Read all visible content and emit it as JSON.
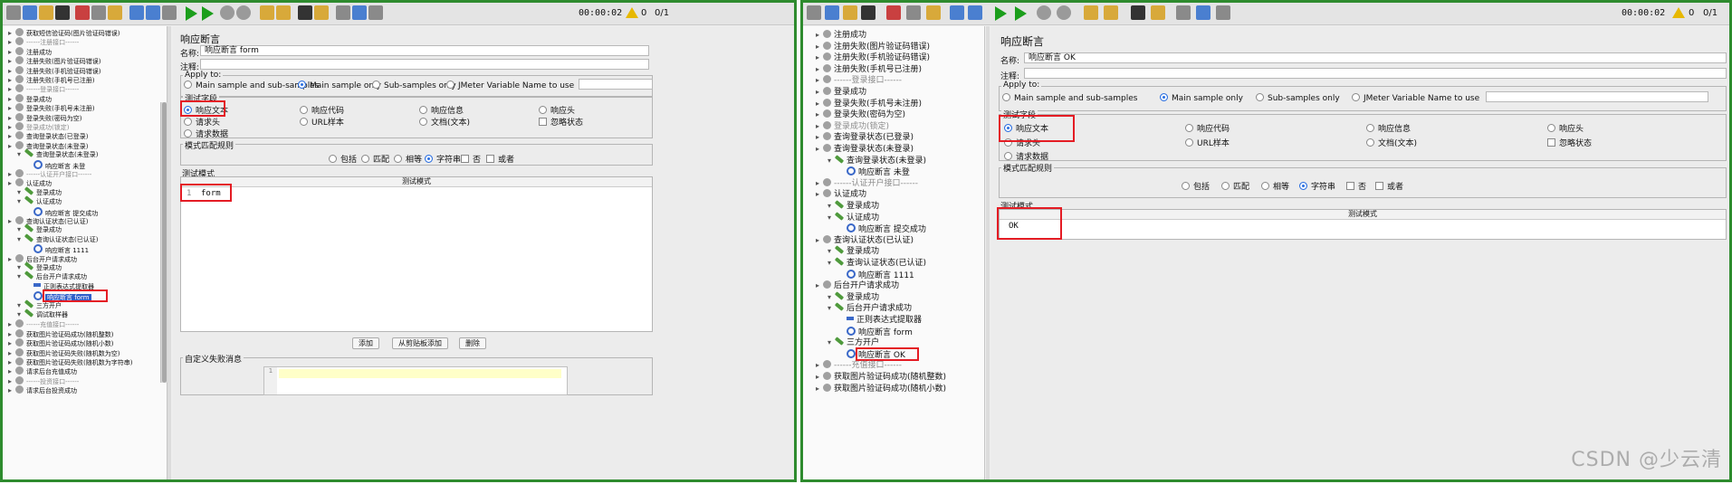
{
  "toolbar": {
    "timer": "00:00:02",
    "warnings": "0",
    "threads": "0/1"
  },
  "left_tree": [
    {
      "text": "获取短信验证码(图片验证码错误)",
      "icon": "g",
      "lvl": 1
    },
    {
      "text": "------注册接口------",
      "icon": "g",
      "lvl": 1,
      "dim": true
    },
    {
      "text": "注册成功",
      "icon": "g",
      "lvl": 1
    },
    {
      "text": "注册失败(图片验证码错误)",
      "icon": "g",
      "lvl": 1
    },
    {
      "text": "注册失败(手机验证码错误)",
      "icon": "g",
      "lvl": 1
    },
    {
      "text": "注册失败(手机号已注册)",
      "icon": "g",
      "lvl": 1
    },
    {
      "text": "------登录接口------",
      "icon": "g",
      "lvl": 1,
      "dim": true
    },
    {
      "text": "登录成功",
      "icon": "g",
      "lvl": 1
    },
    {
      "text": "登录失败(手机号未注册)",
      "icon": "g",
      "lvl": 1
    },
    {
      "text": "登录失败(密码为空)",
      "icon": "g",
      "lvl": 1
    },
    {
      "text": "登录成功(锁定)",
      "icon": "g",
      "lvl": 1,
      "dim": true
    },
    {
      "text": "查询登录状态(已登录)",
      "icon": "g",
      "lvl": 1
    },
    {
      "text": "查询登录状态(未登录)",
      "icon": "g",
      "lvl": 1
    },
    {
      "text": "查询登录状态(未登录)",
      "icon": "s",
      "lvl": 2
    },
    {
      "text": "响应断言 未登",
      "icon": "a",
      "lvl": 3
    },
    {
      "text": "------认证开户接口------",
      "icon": "g",
      "lvl": 1,
      "dim": true
    },
    {
      "text": "认证成功",
      "icon": "g",
      "lvl": 1
    },
    {
      "text": "登录成功",
      "icon": "s",
      "lvl": 2
    },
    {
      "text": "认证成功",
      "icon": "s",
      "lvl": 2
    },
    {
      "text": "响应断言 提交成功",
      "icon": "a",
      "lvl": 3
    },
    {
      "text": "查询认证状态(已认证)",
      "icon": "g",
      "lvl": 1
    },
    {
      "text": "登录成功",
      "icon": "s",
      "lvl": 2
    },
    {
      "text": "查询认证状态(已认证)",
      "icon": "s",
      "lvl": 2
    },
    {
      "text": "响应断言 1111",
      "icon": "a",
      "lvl": 3
    },
    {
      "text": "后台开户请求成功",
      "icon": "g",
      "lvl": 1
    },
    {
      "text": "登录成功",
      "icon": "s",
      "lvl": 2
    },
    {
      "text": "后台开户请求成功",
      "icon": "s",
      "lvl": 2
    },
    {
      "text": "正则表达式提取器",
      "icon": "r",
      "lvl": 3
    },
    {
      "text": "响应断言 form",
      "icon": "a",
      "lvl": 3,
      "selected": true
    },
    {
      "text": "三方开户",
      "icon": "s",
      "lvl": 2
    },
    {
      "text": "调试取样器",
      "icon": "s",
      "lvl": 2
    },
    {
      "text": "------充值接口------",
      "icon": "g",
      "lvl": 1,
      "dim": true
    },
    {
      "text": "获取图片验证码成功(随机整数)",
      "icon": "g",
      "lvl": 1
    },
    {
      "text": "获取图片验证码成功(随机小数)",
      "icon": "g",
      "lvl": 1
    },
    {
      "text": "获取图片验证码失败(随机数为空)",
      "icon": "g",
      "lvl": 1
    },
    {
      "text": "获取图片验证码失败(随机数为字符串)",
      "icon": "g",
      "lvl": 1
    },
    {
      "text": "请求后台充值成功",
      "icon": "g",
      "lvl": 1
    },
    {
      "text": "------投资接口------",
      "icon": "g",
      "lvl": 1,
      "dim": true
    },
    {
      "text": "请求后台投资成功",
      "icon": "g",
      "lvl": 1
    }
  ],
  "right_tree": [
    {
      "text": "注册成功",
      "icon": "g",
      "lvl": 1
    },
    {
      "text": "注册失败(图片验证码错误)",
      "icon": "g",
      "lvl": 1
    },
    {
      "text": "注册失败(手机验证码错误)",
      "icon": "g",
      "lvl": 1
    },
    {
      "text": "注册失败(手机号已注册)",
      "icon": "g",
      "lvl": 1
    },
    {
      "text": "------登录接口------",
      "icon": "g",
      "lvl": 1,
      "dim": true
    },
    {
      "text": "登录成功",
      "icon": "g",
      "lvl": 1
    },
    {
      "text": "登录失败(手机号未注册)",
      "icon": "g",
      "lvl": 1
    },
    {
      "text": "登录失败(密码为空)",
      "icon": "g",
      "lvl": 1
    },
    {
      "text": "登录成功(锁定)",
      "icon": "g",
      "lvl": 1,
      "dim": true
    },
    {
      "text": "查询登录状态(已登录)",
      "icon": "g",
      "lvl": 1
    },
    {
      "text": "查询登录状态(未登录)",
      "icon": "g",
      "lvl": 1
    },
    {
      "text": "查询登录状态(未登录)",
      "icon": "s",
      "lvl": 2
    },
    {
      "text": "响应断言 未登",
      "icon": "a",
      "lvl": 3
    },
    {
      "text": "------认证开户接口------",
      "icon": "g",
      "lvl": 1,
      "dim": true
    },
    {
      "text": "认证成功",
      "icon": "g",
      "lvl": 1
    },
    {
      "text": "登录成功",
      "icon": "s",
      "lvl": 2
    },
    {
      "text": "认证成功",
      "icon": "s",
      "lvl": 2
    },
    {
      "text": "响应断言 提交成功",
      "icon": "a",
      "lvl": 3
    },
    {
      "text": "查询认证状态(已认证)",
      "icon": "g",
      "lvl": 1
    },
    {
      "text": "登录成功",
      "icon": "s",
      "lvl": 2
    },
    {
      "text": "查询认证状态(已认证)",
      "icon": "s",
      "lvl": 2
    },
    {
      "text": "响应断言 1111",
      "icon": "a",
      "lvl": 3
    },
    {
      "text": "后台开户请求成功",
      "icon": "g",
      "lvl": 1
    },
    {
      "text": "登录成功",
      "icon": "s",
      "lvl": 2
    },
    {
      "text": "后台开户请求成功",
      "icon": "s",
      "lvl": 2
    },
    {
      "text": "正则表达式提取器",
      "icon": "r",
      "lvl": 3
    },
    {
      "text": "响应断言 form",
      "icon": "a",
      "lvl": 3
    },
    {
      "text": "三方开户",
      "icon": "s",
      "lvl": 2
    },
    {
      "text": "响应断言 OK",
      "icon": "a",
      "lvl": 3,
      "boxed": true
    },
    {
      "text": "------充值接口------",
      "icon": "g",
      "lvl": 1,
      "dim": true
    },
    {
      "text": "获取图片验证码成功(随机整数)",
      "icon": "g",
      "lvl": 1
    },
    {
      "text": "获取图片验证码成功(随机小数)",
      "icon": "g",
      "lvl": 1
    }
  ],
  "left_panel": {
    "title": "响应断言",
    "name_label": "名称:",
    "name_value": "响应断言 form",
    "comment_label": "注释:",
    "apply_to": "Apply to:",
    "apply_options": [
      "Main sample and sub-samples",
      "Main sample only",
      "Sub-samples only",
      "JMeter Variable Name to use"
    ],
    "field_group": "测试字段",
    "fields": [
      "响应文本",
      "响应代码",
      "响应信息",
      "响应头",
      "请求头",
      "URL样本",
      "文档(文本)",
      "忽略状态",
      "请求数据"
    ],
    "rule_group": "模式匹配规则",
    "rules": [
      "包括",
      "匹配",
      "相等",
      "字符串",
      "否",
      "或者"
    ],
    "pattern_group": "测试模式",
    "pattern_header": "测试模式",
    "pattern_line_no": "1",
    "pattern_value": "form",
    "buttons": [
      "添加",
      "从剪贴板添加",
      "删除"
    ],
    "custom_fail": "自定义失败消息",
    "custom_fail_line": "1"
  },
  "right_panel": {
    "title": "响应断言",
    "name_label": "名称:",
    "name_value": "响应断言 OK",
    "comment_label": "注释:",
    "apply_to": "Apply to:",
    "apply_options": [
      "Main sample and sub-samples",
      "Main sample only",
      "Sub-samples only",
      "JMeter Variable Name to use"
    ],
    "field_group": "测试字段",
    "fields": [
      "响应文本",
      "响应代码",
      "响应信息",
      "响应头",
      "请求头",
      "URL样本",
      "文档(文本)",
      "忽略状态",
      "请求数据"
    ],
    "rule_group": "模式匹配规则",
    "rules": [
      "包括",
      "匹配",
      "相等",
      "字符串",
      "否",
      "或者"
    ],
    "pattern_group": "测试模式",
    "pattern_header": "测试模式",
    "pattern_value": "OK"
  },
  "watermark": "CSDN @少云清"
}
